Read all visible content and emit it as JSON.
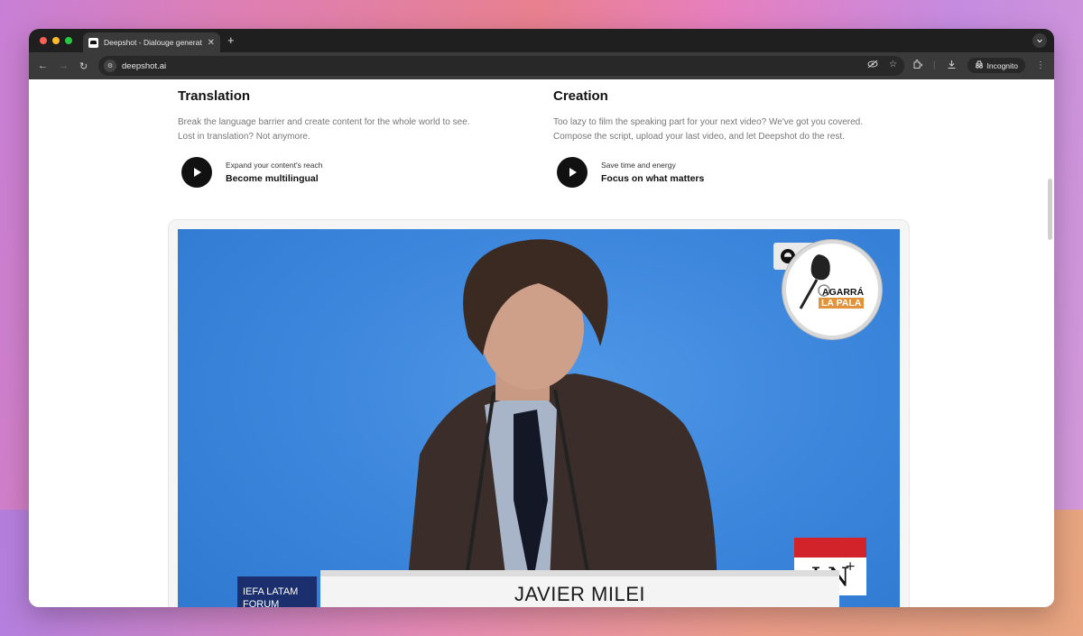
{
  "browser": {
    "tab_title": "Deepshot - Dialouge generat",
    "tab_close": "✕",
    "new_tab": "+",
    "url": "deepshot.ai",
    "incognito_label": "Incognito",
    "menu_dots": "⋮"
  },
  "features": [
    {
      "title": "Translation",
      "desc_1": "Break the language barrier and create content for the whole world to see.",
      "desc_2": "Lost in translation? Not anymore.",
      "cta_sub": "Expand your content's reach",
      "cta_main": "Become multilingual"
    },
    {
      "title": "Creation",
      "desc_1": "Too lazy to film the speaking part for your next video? We've got you covered.",
      "desc_2": "Compose the script, upload your last video, and let Deepshot do the rest.",
      "cta_sub": "Save time and energy",
      "cta_main": "Focus on what matters"
    }
  ],
  "video": {
    "corner_partial": "IF",
    "agarra_line1": "AGARRÁ",
    "agarra_line2": "LA PALA",
    "ribbon_line1": "IEFA LATAM",
    "ribbon_line2": "FORUM",
    "name": "JAVIER MILEI",
    "ln_text": "LN",
    "ln_plus": "+"
  },
  "colors": {
    "accent_dark": "#111111",
    "video_blue": "#3d87dd",
    "ln_red": "#d2232a",
    "agarra_orange": "#e2923a"
  }
}
